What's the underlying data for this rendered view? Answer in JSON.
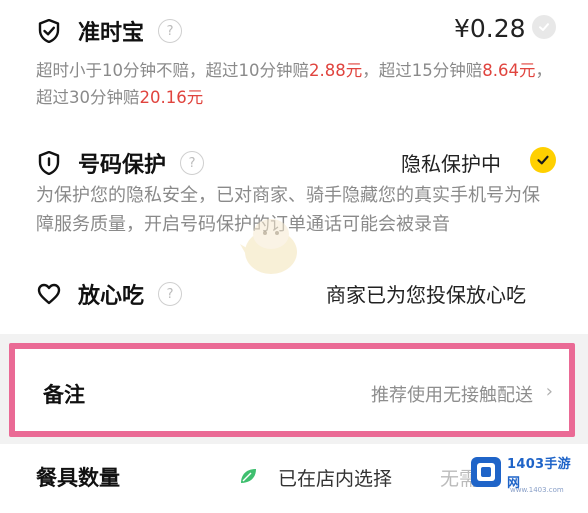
{
  "ontime": {
    "title": "准时宝",
    "help": "?",
    "price": "¥0.28",
    "desc_1": "超时小于10分钟不赔，超过10分钟赔",
    "amount_1": "2.88元",
    "desc_2": "，超过15分钟赔",
    "amount_2": "8.64元",
    "desc_3": "，超过30分钟赔",
    "amount_3": "20.16元",
    "check_state": "unchecked"
  },
  "privacy": {
    "title": "号码保护",
    "help": "?",
    "status": "隐私保护中",
    "desc": "为保护您的隐私安全，已对商家、骑手隐藏您的真实手机号为保障服务质量，开启号码保护的订单通话可能会被录音",
    "check_state": "checked"
  },
  "assure": {
    "title": "放心吃",
    "help": "?",
    "status": "商家已为您投保放心吃"
  },
  "note": {
    "label": "备注",
    "value": "推荐使用无接触配送",
    "chevron": "›"
  },
  "tableware": {
    "label": "餐具数量",
    "value": "已在店内选择",
    "value_faded": "无需"
  },
  "watermark": {
    "brand": "1403手游网",
    "url": "www.1403.com"
  },
  "colors": {
    "accent_yellow": "#ffd000",
    "red_amount": "#e0443e",
    "highlight_border": "#ea6a95",
    "leaf_green": "#3fbf6f"
  }
}
